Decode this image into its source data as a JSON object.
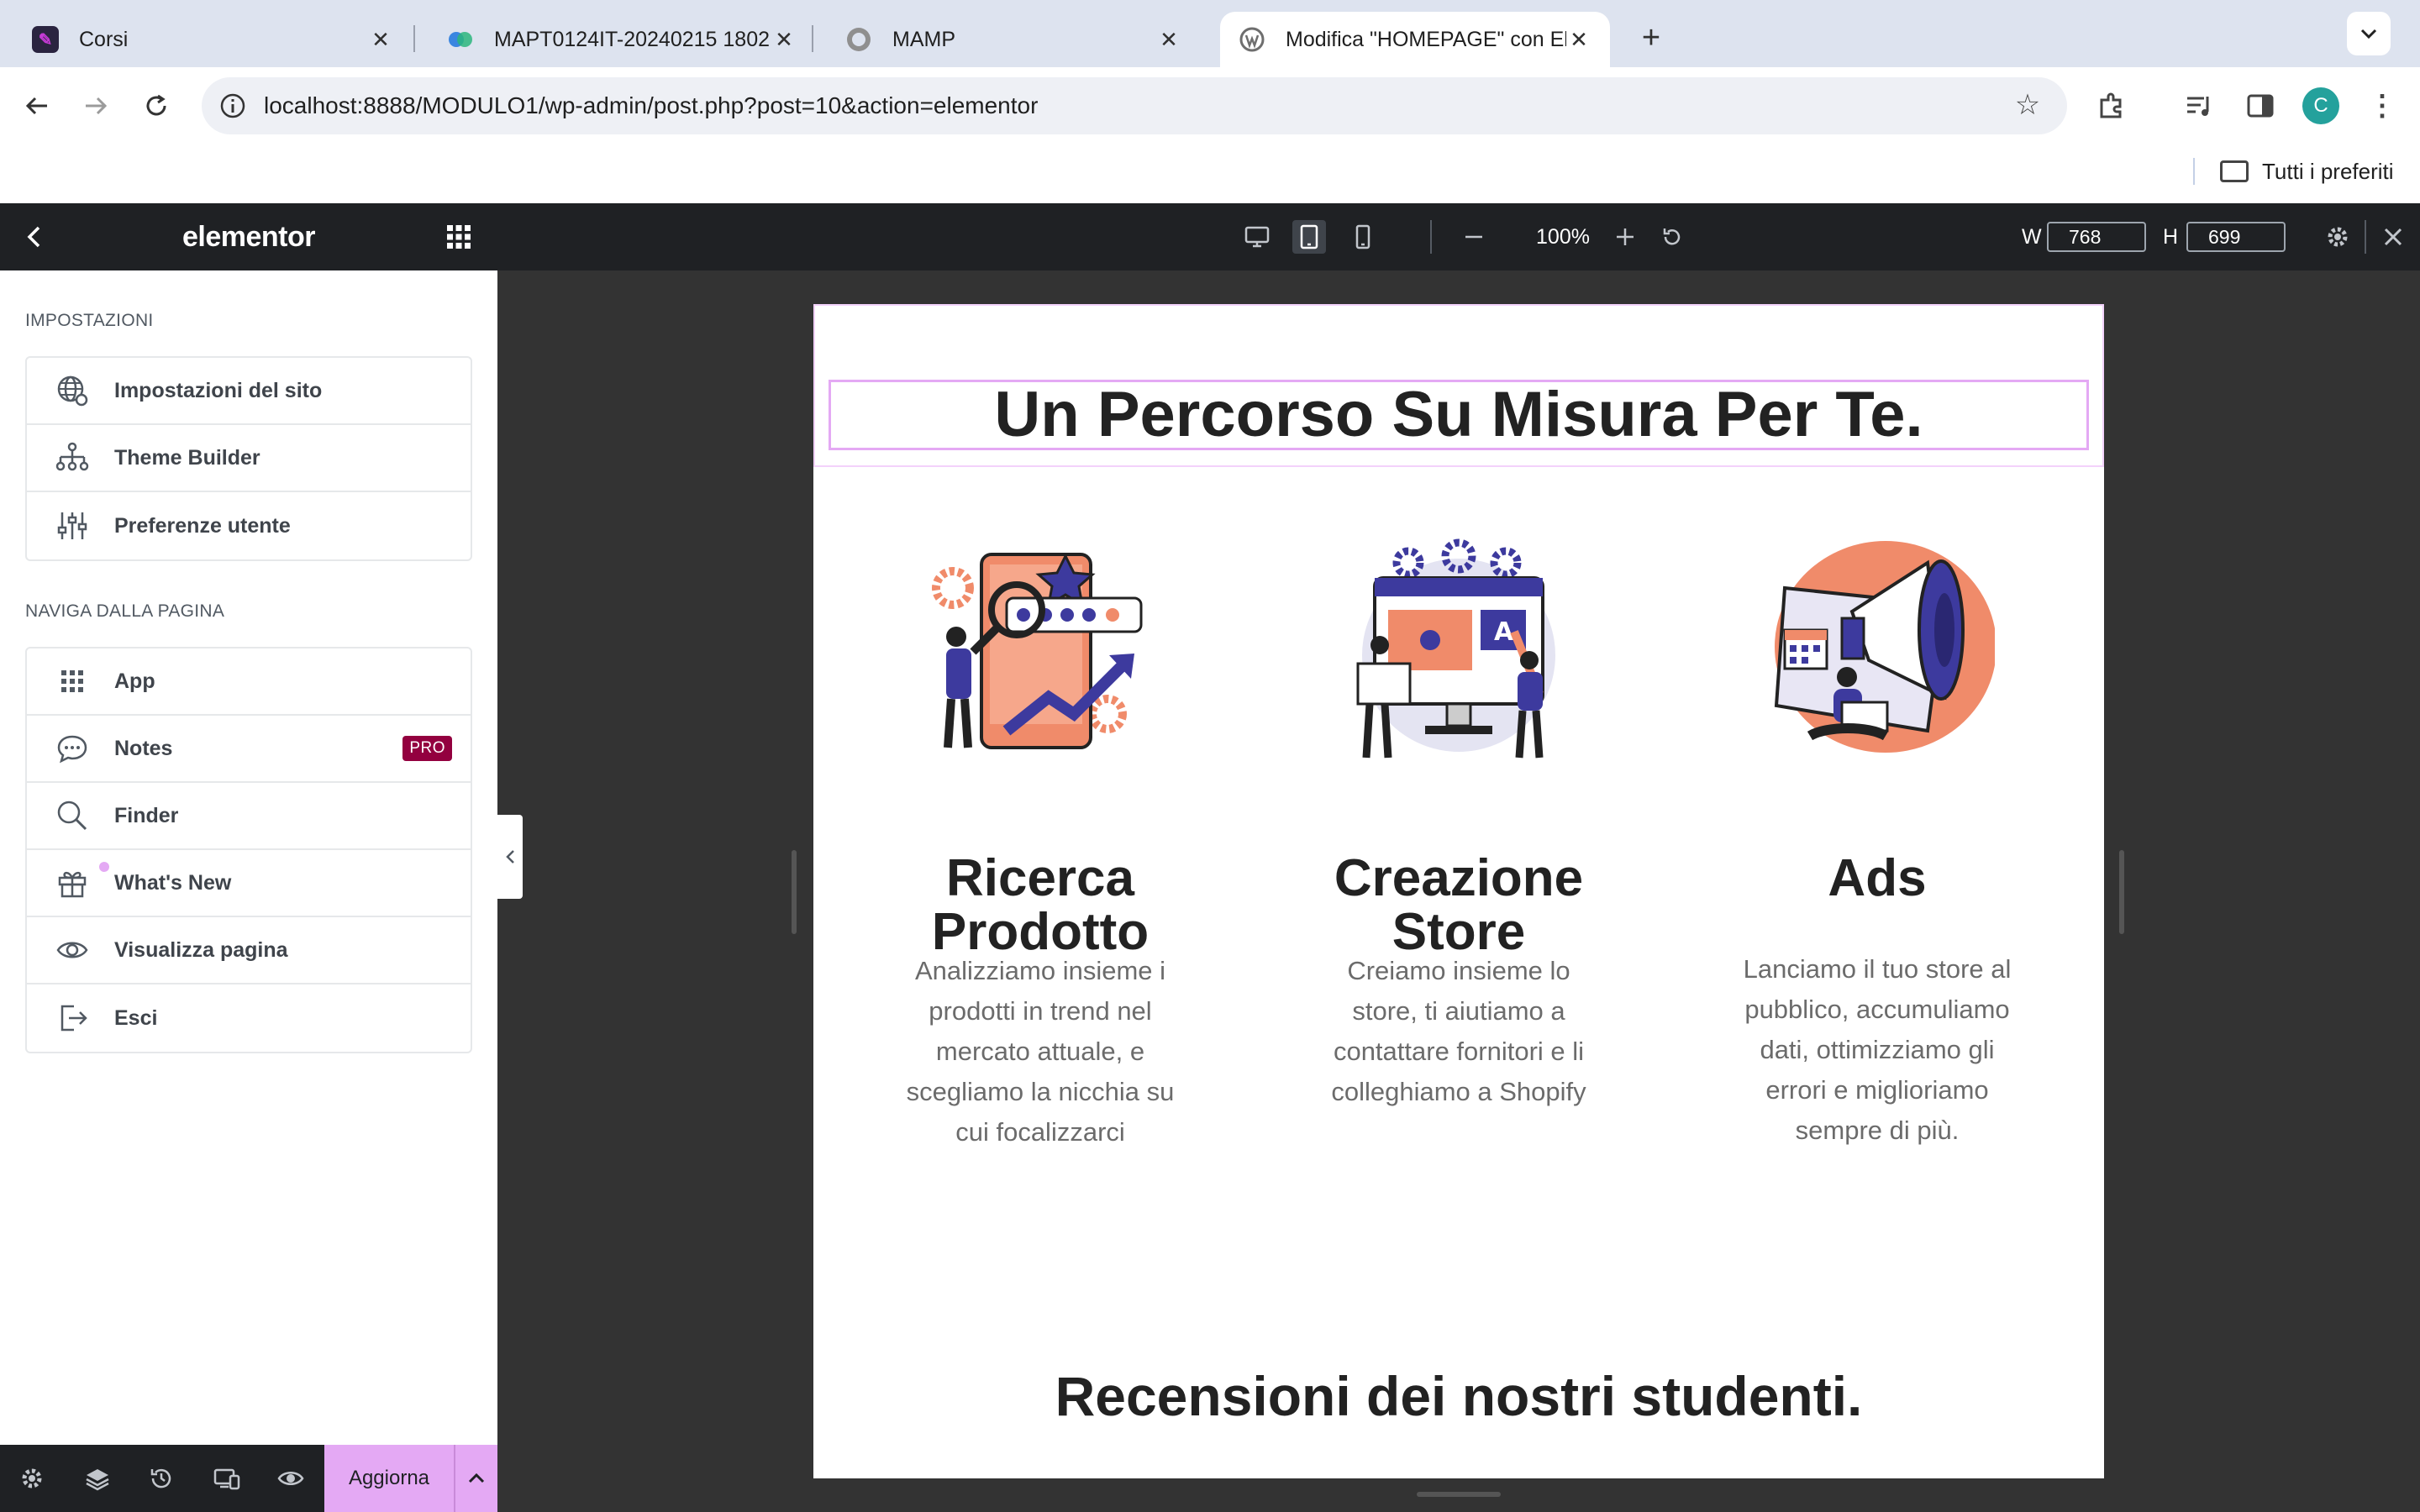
{
  "browser": {
    "tabs": [
      {
        "title": "Corsi",
        "favicon": "corsi-favicon",
        "active": false
      },
      {
        "title": "MAPT0124IT-20240215 1802",
        "favicon": "webex-favicon",
        "active": false
      },
      {
        "title": "MAMP",
        "favicon": "mamp-favicon",
        "active": false
      },
      {
        "title": "Modifica \"HOMEPAGE\" con El",
        "favicon": "wordpress-favicon",
        "active": true
      }
    ],
    "url": "localhost:8888/MODULO1/wp-admin/post.php?post=10&action=elementor",
    "profile_initial": "C",
    "bookmarks_folder": "Tutti i preferiti"
  },
  "elementor": {
    "logo": "elementor",
    "settings_title": "IMPOSTAZIONI",
    "settings_items": [
      {
        "label": "Impostazioni del sito",
        "icon": "globe-settings-icon"
      },
      {
        "label": "Theme Builder",
        "icon": "sitemap-icon"
      },
      {
        "label": "Preferenze utente",
        "icon": "sliders-icon"
      }
    ],
    "navigate_title": "NAVIGA DALLA PAGINA",
    "navigate_items": [
      {
        "label": "App",
        "icon": "apps-grid-icon"
      },
      {
        "label": "Notes",
        "icon": "chat-bubble-icon",
        "badge": "PRO"
      },
      {
        "label": "Finder",
        "icon": "search-icon"
      },
      {
        "label": "What's New",
        "icon": "gift-icon"
      },
      {
        "label": "Visualizza pagina",
        "icon": "eye-icon"
      },
      {
        "label": "Esci",
        "icon": "exit-icon"
      }
    ],
    "publish_label": "Aggiorna",
    "accent_color": "#e4a9f4",
    "pro_badge_color": "#93003f"
  },
  "responsive_bar": {
    "zoom": "100%",
    "width_label": "W",
    "width_value": "768",
    "height_label": "H",
    "height_value": "699",
    "active_device": "tablet"
  },
  "page": {
    "heading": "Un Percorso Su Misura Per Te.",
    "columns": [
      {
        "title_line1": "Ricerca",
        "title_line2": "Prodotto",
        "text": "Analizziamo insieme i prodotti in trend nel mercato attuale, e scegliamo la nicchia su cui focalizzarci",
        "illustration": "product-research-illustration"
      },
      {
        "title_line1": "Creazione",
        "title_line2": "Store",
        "text": "Creiamo insieme lo store, ti aiutiamo a contattare fornitori e li colleghiamo a Shopify",
        "illustration": "store-creation-illustration"
      },
      {
        "title_line1": "Ads",
        "title_line2": "",
        "text": "Lanciamo il tuo store al pubblico, accumuliamo dati, ottimizziamo gli errori e miglioriamo sempre di più.",
        "illustration": "megaphone-ads-illustration"
      }
    ],
    "reviews_heading": "Recensioni dei nostri studenti."
  }
}
